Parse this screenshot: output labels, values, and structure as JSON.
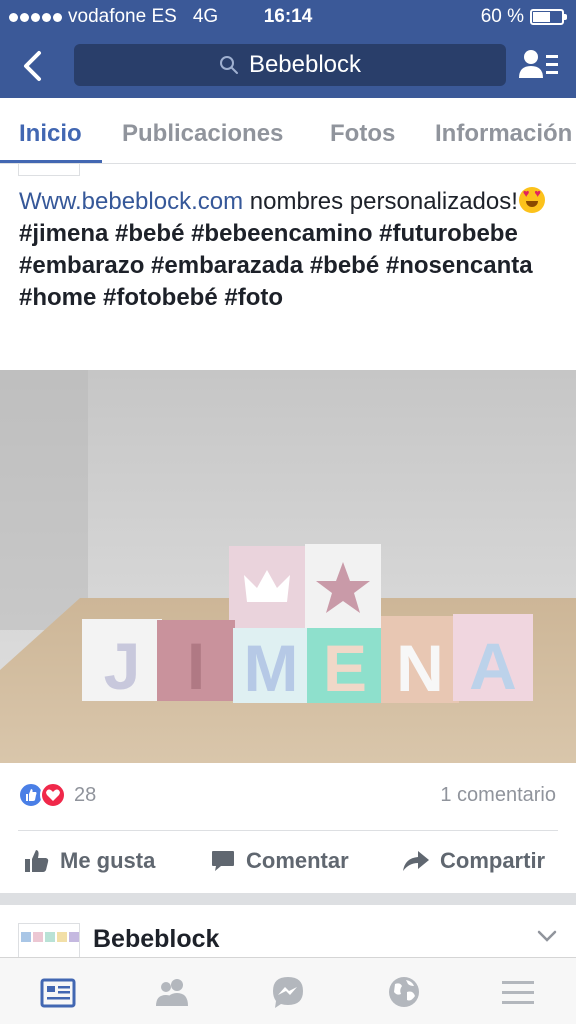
{
  "status_bar": {
    "carrier": "vodafone ES",
    "network": "4G",
    "time": "16:14",
    "battery_text": "60 %",
    "battery_level": 0.6
  },
  "nav_bar": {
    "search_text": "Bebeblock",
    "back_icon": "chevron-left-icon",
    "search_icon": "search-icon",
    "profile_icon": "page-profile-icon"
  },
  "tabs": [
    {
      "label": "Inicio",
      "active": true
    },
    {
      "label": "Publicaciones",
      "active": false
    },
    {
      "label": "Fotos",
      "active": false
    },
    {
      "label": "Información",
      "active": false
    }
  ],
  "post": {
    "text_link": "Www.bebeblock.com",
    "text_plain": "nombres personalizados!",
    "hashtags": "#jimena #bebé #bebeencamino #futurobebe #embarazo #embarazada #bebé #nosencanta #home #fotobebé #foto",
    "photo_letters": [
      "J",
      "I",
      "M",
      "E",
      "N",
      "A"
    ],
    "reaction_count": "28",
    "comments_label": "1 comentario",
    "actions": {
      "like": "Me gusta",
      "comment": "Comentar",
      "share": "Compartir"
    }
  },
  "next_post": {
    "page_name": "Bebeblock"
  },
  "bottom_bar": {
    "items": [
      "feed-icon",
      "friends-icon",
      "messenger-icon",
      "globe-icon",
      "menu-icon"
    ]
  },
  "colors": {
    "brand": "#3b5998",
    "accent": "#4267b2",
    "secondary_text": "#90949c"
  }
}
